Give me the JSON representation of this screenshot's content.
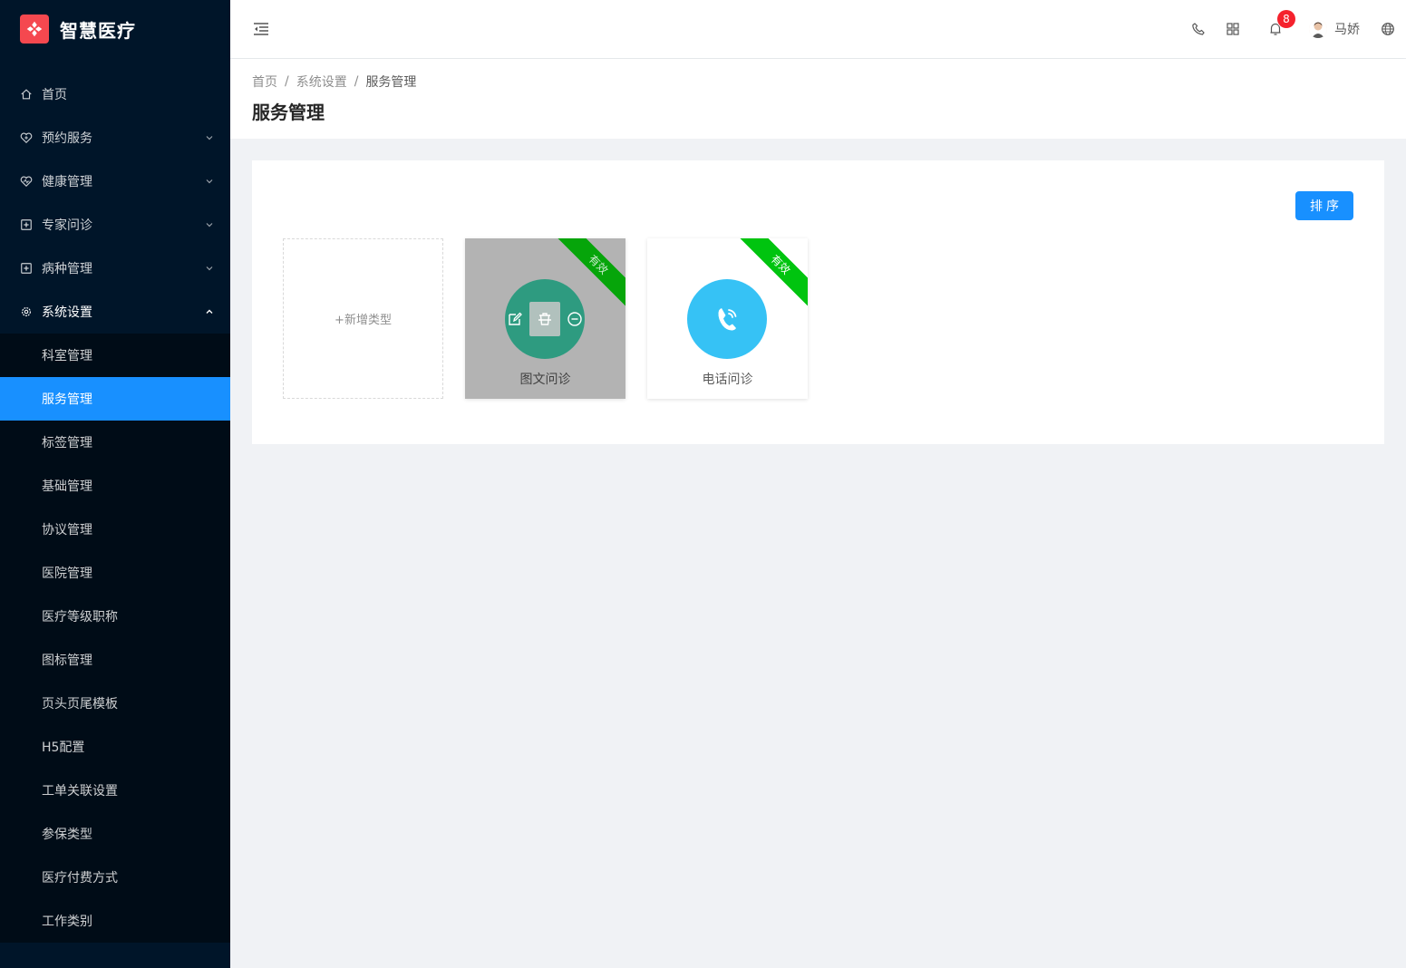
{
  "app": {
    "title": "智慧医疗"
  },
  "sidebar": {
    "items": [
      {
        "label": "首页",
        "icon": "home-icon"
      },
      {
        "label": "预约服务",
        "icon": "heart-icon"
      },
      {
        "label": "健康管理",
        "icon": "heart-pulse-icon"
      },
      {
        "label": "专家问诊",
        "icon": "medical-box-icon"
      },
      {
        "label": "病种管理",
        "icon": "medical-box-icon"
      },
      {
        "label": "系统设置",
        "icon": "gear-icon"
      }
    ],
    "system_sub": [
      "科室管理",
      "服务管理",
      "标签管理",
      "基础管理",
      "协议管理",
      "医院管理",
      "医疗等级职称",
      "图标管理",
      "页头页尾模板",
      "H5配置",
      "工单关联设置",
      "参保类型",
      "医疗付费方式",
      "工作类别"
    ],
    "active_sub": "服务管理"
  },
  "header": {
    "notification_count": "8",
    "user_name": "马娇"
  },
  "breadcrumb": {
    "home": "首页",
    "parent": "系统设置",
    "current": "服务管理"
  },
  "page": {
    "title": "服务管理",
    "sort_label": "排序"
  },
  "cards": {
    "add_label": "+新增类型",
    "items": [
      {
        "name": "图文问诊",
        "status": "有效",
        "color": "#2e9b80"
      },
      {
        "name": "电话问诊",
        "status": "有效",
        "color": "#36c2f5"
      }
    ]
  },
  "colors": {
    "primary": "#1890ff",
    "sidebar_bg": "#001529",
    "valid": "#00c40f"
  }
}
